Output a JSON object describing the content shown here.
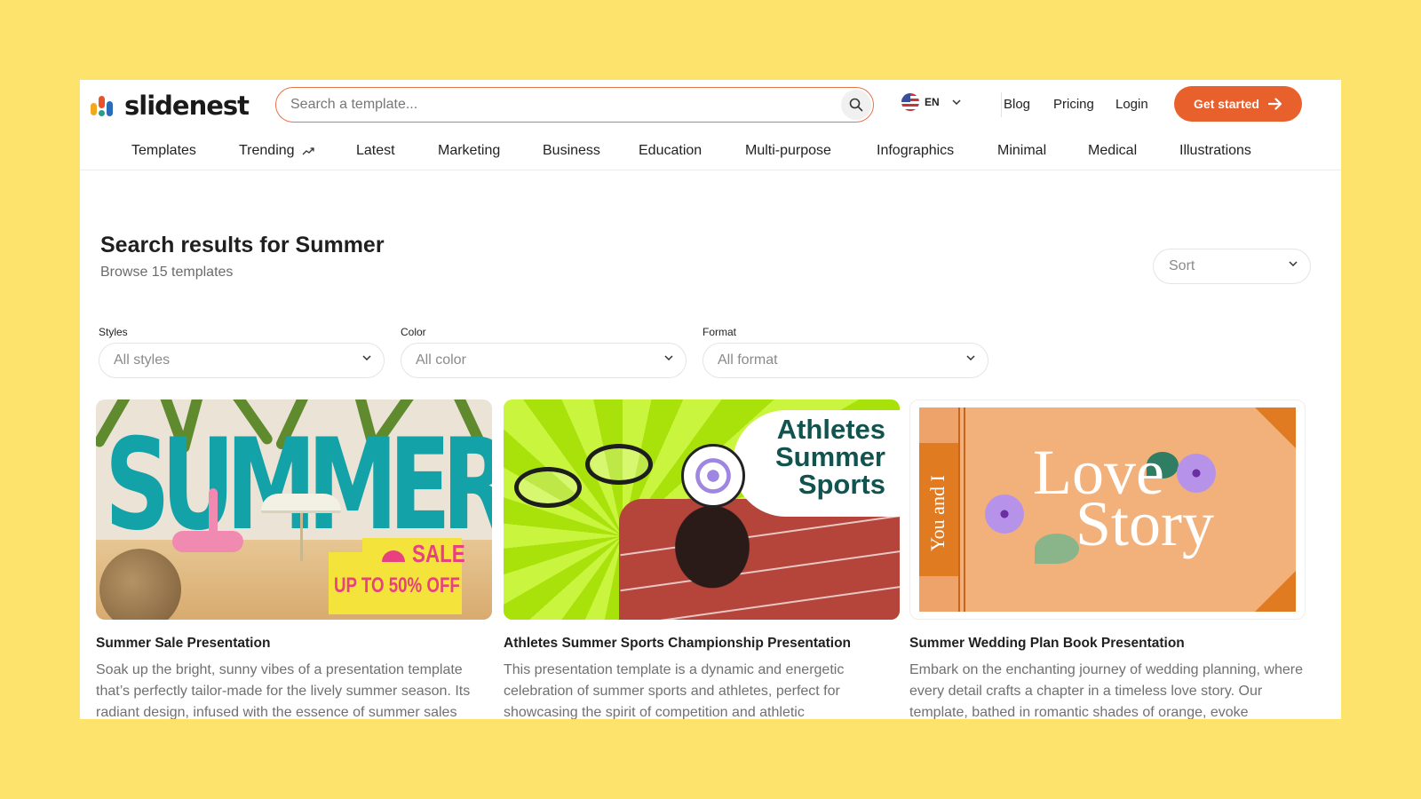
{
  "brand": {
    "name": "slidenest"
  },
  "header": {
    "search_placeholder": "Search a template...",
    "language": "EN",
    "links": [
      "Blog",
      "Pricing",
      "Login"
    ],
    "cta_label": "Get started"
  },
  "nav": {
    "items": [
      "Templates",
      "Trending",
      "Latest",
      "Marketing",
      "Business",
      "Education",
      "Multi-purpose",
      "Infographics",
      "Minimal",
      "Medical",
      "Illustrations"
    ]
  },
  "results": {
    "title": "Search results for Summer",
    "subtitle": "Browse 15 templates",
    "sort_label": "Sort"
  },
  "filters": [
    {
      "label": "Styles",
      "value": "All styles"
    },
    {
      "label": "Color",
      "value": "All color"
    },
    {
      "label": "Format",
      "value": "All format"
    }
  ],
  "cards": [
    {
      "title": "Summer Sale Presentation",
      "description": "Soak up the bright, sunny vibes of a presentation template that’s perfectly tailor-made for the lively summer season. Its radiant design, infused with the essence of summer sales",
      "thumb_text": {
        "word": "SUMMER",
        "sale": "SALE",
        "offer": "UP TO 50% OFF"
      }
    },
    {
      "title": "Athletes Summer Sports Championship Presentation",
      "description": "This presentation template is a dynamic and energetic celebration of summer sports and athletes, perfect for showcasing the spirit of competition and athletic",
      "thumb_text": {
        "line1": "Athletes",
        "line2": "Summer",
        "line3": "Sports"
      }
    },
    {
      "title": "Summer Wedding Plan Book Presentation",
      "description": "Embark on the enchanting journey of wedding planning, where every detail crafts a chapter in a timeless love story. Our template, bathed in romantic shades of orange, evoke",
      "thumb_text": {
        "spine": "You and I",
        "line1": "Love",
        "line2": "Story"
      }
    }
  ],
  "colors": {
    "page_bg": "#fde36b",
    "accent": "#e8602c",
    "search_border": "#e8724a"
  }
}
